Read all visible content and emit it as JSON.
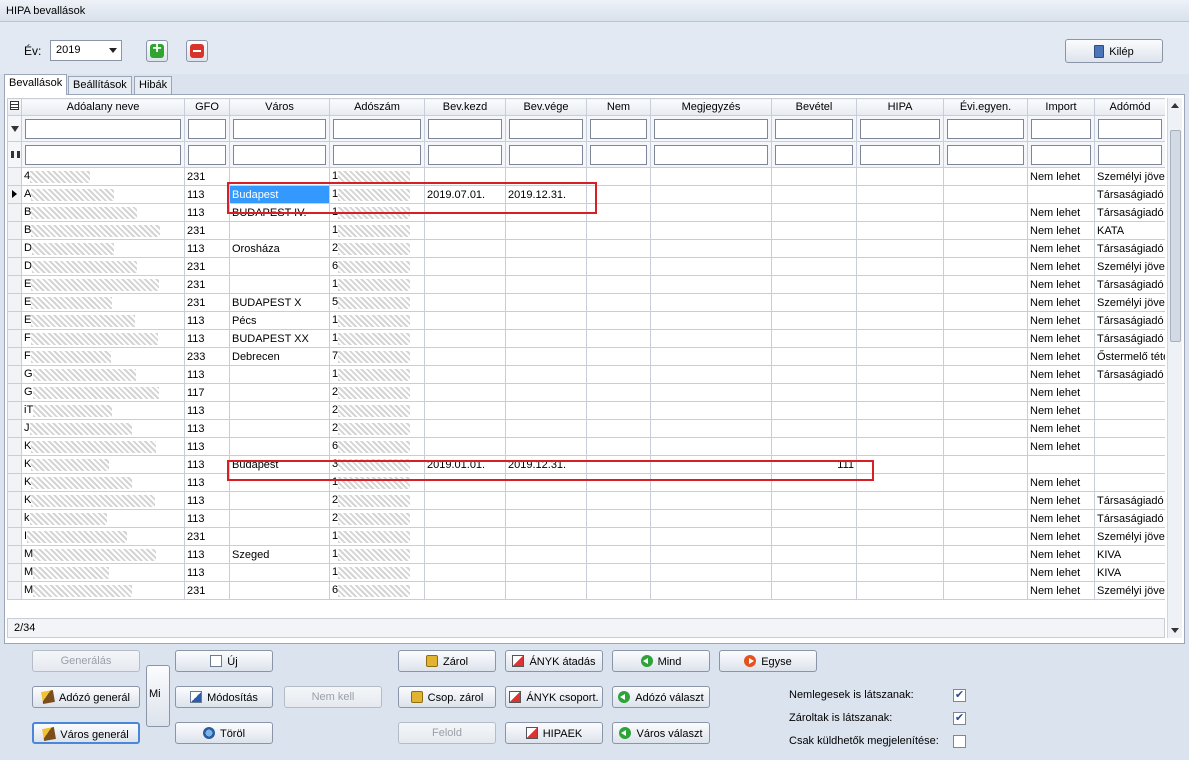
{
  "window": {
    "title": "HIPA bevallások"
  },
  "toolbar": {
    "year_label": "Év:",
    "year_value": "2019",
    "exit_label": "Kilép"
  },
  "tabs": [
    {
      "label": "Bevallások"
    },
    {
      "label": "Beállítások"
    },
    {
      "label": "Hibák"
    }
  ],
  "grid": {
    "columns": [
      "Adóalany neve",
      "GFO",
      "Város",
      "Adószám",
      "Bev.kezd",
      "Bev.vége",
      "Nem",
      "Megjegyzés",
      "Bevétel",
      "HIPA",
      "Évi.egyen.",
      "Import",
      "Adómód"
    ],
    "rows": [
      {
        "name": "4",
        "gfo": "231",
        "city": "",
        "tax": "1",
        "start": "",
        "end": "",
        "income": "",
        "import": "Nem lehet",
        "mode": "Személyi jöve"
      },
      {
        "name": "A",
        "gfo": "113",
        "city": "Budapest",
        "tax": "1",
        "start": "2019.07.01.",
        "end": "2019.12.31.",
        "income": "",
        "import": "",
        "mode": "Társaságiadó"
      },
      {
        "name": "B",
        "gfo": "113",
        "city": "BUDAPEST IV.",
        "tax": "1",
        "start": "",
        "end": "",
        "income": "",
        "import": "Nem lehet",
        "mode": "Társaságiadó"
      },
      {
        "name": "B",
        "gfo": "231",
        "city": "",
        "tax": "1",
        "start": "",
        "end": "",
        "income": "",
        "import": "Nem lehet",
        "mode": "KATA"
      },
      {
        "name": "D",
        "gfo": "113",
        "city": "Orosháza",
        "tax": "2",
        "start": "",
        "end": "",
        "income": "",
        "import": "Nem lehet",
        "mode": "Társaságiadó"
      },
      {
        "name": "D",
        "gfo": "231",
        "city": "",
        "tax": "6",
        "start": "",
        "end": "",
        "income": "",
        "import": "Nem lehet",
        "mode": "Személyi jöve"
      },
      {
        "name": "E",
        "gfo": "231",
        "city": "",
        "tax": "1",
        "start": "",
        "end": "",
        "income": "",
        "import": "Nem lehet",
        "mode": "Társaságiadó"
      },
      {
        "name": "E",
        "gfo": "231",
        "city": "BUDAPEST X",
        "tax": "5",
        "start": "",
        "end": "",
        "income": "",
        "import": "Nem lehet",
        "mode": "Személyi jöve"
      },
      {
        "name": "E",
        "gfo": "113",
        "city": "Pécs",
        "tax": "1",
        "start": "",
        "end": "",
        "income": "",
        "import": "Nem lehet",
        "mode": "Társaságiadó"
      },
      {
        "name": "F",
        "gfo": "113",
        "city": "BUDAPEST XX",
        "tax": "1",
        "start": "",
        "end": "",
        "income": "",
        "import": "Nem lehet",
        "mode": "Társaságiadó"
      },
      {
        "name": "F",
        "gfo": "233",
        "city": "Debrecen",
        "tax": "7",
        "start": "",
        "end": "",
        "income": "",
        "import": "Nem lehet",
        "mode": "Őstermelő téte"
      },
      {
        "name": "G",
        "gfo": "113",
        "city": "",
        "tax": "1",
        "start": "",
        "end": "",
        "income": "",
        "import": "Nem lehet",
        "mode": "Társaságiadó"
      },
      {
        "name": "G",
        "gfo": "117",
        "city": "",
        "tax": "2",
        "start": "",
        "end": "",
        "income": "",
        "import": "Nem lehet",
        "mode": ""
      },
      {
        "name": "iT",
        "gfo": "113",
        "city": "",
        "tax": "2",
        "start": "",
        "end": "",
        "income": "",
        "import": "Nem lehet",
        "mode": ""
      },
      {
        "name": "J",
        "gfo": "113",
        "city": "",
        "tax": "2",
        "start": "",
        "end": "",
        "income": "",
        "import": "Nem lehet",
        "mode": ""
      },
      {
        "name": "K",
        "gfo": "113",
        "city": "",
        "tax": "6",
        "start": "",
        "end": "",
        "income": "",
        "import": "Nem lehet",
        "mode": ""
      },
      {
        "name": "K",
        "gfo": "113",
        "city": "Budapest",
        "tax": "3",
        "start": "2019.01.01.",
        "end": "2019.12.31.",
        "income": "111",
        "import": "",
        "mode": ""
      },
      {
        "name": "K",
        "gfo": "113",
        "city": "",
        "tax": "1",
        "start": "",
        "end": "",
        "income": "",
        "import": "Nem lehet",
        "mode": ""
      },
      {
        "name": "K",
        "gfo": "113",
        "city": "",
        "tax": "2",
        "start": "",
        "end": "",
        "income": "",
        "import": "Nem lehet",
        "mode": "Társaságiadó"
      },
      {
        "name": "k",
        "gfo": "113",
        "city": "",
        "tax": "2",
        "start": "",
        "end": "",
        "income": "",
        "import": "Nem lehet",
        "mode": "Társaságiadó"
      },
      {
        "name": "I",
        "gfo": "231",
        "city": "",
        "tax": "1",
        "start": "",
        "end": "",
        "income": "",
        "import": "Nem lehet",
        "mode": "Személyi jöve"
      },
      {
        "name": "M",
        "gfo": "113",
        "city": "Szeged",
        "tax": "1",
        "start": "",
        "end": "",
        "income": "",
        "import": "Nem lehet",
        "mode": "KIVA"
      },
      {
        "name": "M",
        "gfo": "113",
        "city": "",
        "tax": "1",
        "start": "",
        "end": "",
        "income": "",
        "import": "Nem lehet",
        "mode": "KIVA"
      },
      {
        "name": "M",
        "gfo": "231",
        "city": "",
        "tax": "6",
        "start": "",
        "end": "",
        "income": "",
        "import": "Nem lehet",
        "mode": "Személyi jöve"
      }
    ],
    "status": "2/34"
  },
  "buttons": {
    "generate": "Generálás",
    "new": "Új",
    "taxpayer_generate": "Adózó generál",
    "side": "Mi",
    "modify": "Módosítás",
    "not_needed": "Nem kell",
    "city_generate": "Város generál",
    "delete": "Töröl",
    "lock": "Zárol",
    "group_lock": "Csop. zárol",
    "unlock": "Felold",
    "anyk_transfer": "ÁNYK átadás",
    "anyk_group": "ÁNYK csoport.",
    "hipaek": "HIPAEK",
    "all": "Mind",
    "taxpayer_select": "Adózó választ",
    "city_select": "Város választ",
    "single": "Egyse"
  },
  "options": [
    {
      "label": "Nemlegesek is látszanak:",
      "checked": true
    },
    {
      "label": "Zároltak is látszanak:",
      "checked": true
    },
    {
      "label": "Csak küldhetők megjelenítése:",
      "checked": false
    }
  ],
  "colors": {
    "highlight": "#d81f26",
    "selection": "#3399ff"
  }
}
